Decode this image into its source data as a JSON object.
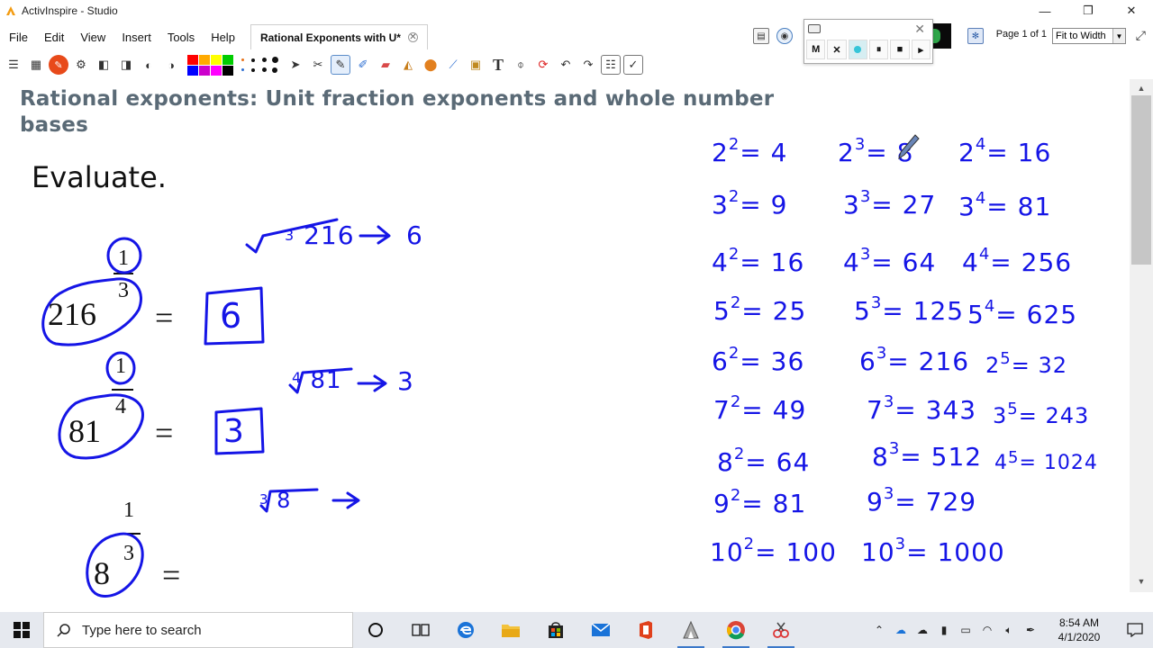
{
  "window": {
    "title": "ActivInspire - Studio",
    "controls": {
      "minimize": "—",
      "restore": "❐",
      "close": "✕"
    }
  },
  "menu": {
    "items": [
      "File",
      "Edit",
      "View",
      "Insert",
      "Tools",
      "Help"
    ]
  },
  "doc_tab": {
    "label": "Rational Exponents with U*"
  },
  "page_nav": {
    "page_label": "Page 1 of 1",
    "zoom": "Fit to Width"
  },
  "recorder": {
    "buttons": [
      "M",
      "✕",
      "",
      "⏸",
      "■",
      "▸"
    ]
  },
  "swatch_colors": [
    "#ff0000",
    "#ffaa00",
    "#ffff00",
    "#00cc00",
    "#0000ff",
    "#cc00cc",
    "#ff00ff",
    "#000000"
  ],
  "lesson": {
    "title": "Rational exponents: Unit fraction exponents and whole number bases",
    "instruction": "Evaluate.",
    "problems": [
      {
        "base": "216",
        "numerator": "1",
        "denominator": "3",
        "equals": "=",
        "work": "∛216 → 6",
        "answer": "6"
      },
      {
        "base": "81",
        "numerator": "1",
        "denominator": "4",
        "equals": "=",
        "work": "∜81 → 3",
        "answer": "3"
      },
      {
        "base": "8",
        "numerator": "1",
        "denominator": "3",
        "equals": "=",
        "work": "∛8 →",
        "answer": ""
      }
    ],
    "ink_color": "#1515e6",
    "power_table": [
      {
        "col": 1,
        "rows": [
          {
            "b": "2",
            "e": "2",
            "v": "= 4"
          },
          {
            "b": "3",
            "e": "2",
            "v": "= 9"
          },
          {
            "b": "4",
            "e": "2",
            "v": "= 16"
          },
          {
            "b": "5",
            "e": "2",
            "v": "= 25"
          },
          {
            "b": "6",
            "e": "2",
            "v": "= 36"
          },
          {
            "b": "7",
            "e": "2",
            "v": "= 49"
          },
          {
            "b": "8",
            "e": "2",
            "v": "= 64"
          },
          {
            "b": "9",
            "e": "2",
            "v": "= 81"
          },
          {
            "b": "10",
            "e": "2",
            "v": "= 100"
          }
        ]
      },
      {
        "col": 2,
        "rows": [
          {
            "b": "2",
            "e": "3",
            "v": "= 8"
          },
          {
            "b": "3",
            "e": "3",
            "v": "= 27"
          },
          {
            "b": "4",
            "e": "3",
            "v": "= 64"
          },
          {
            "b": "5",
            "e": "3",
            "v": "= 125"
          },
          {
            "b": "6",
            "e": "3",
            "v": "= 216"
          },
          {
            "b": "7",
            "e": "3",
            "v": "= 343"
          },
          {
            "b": "8",
            "e": "3",
            "v": "= 512"
          },
          {
            "b": "9",
            "e": "3",
            "v": "= 729"
          },
          {
            "b": "10",
            "e": "3",
            "v": "= 1000"
          }
        ]
      },
      {
        "col": 3,
        "rows": [
          {
            "b": "2",
            "e": "4",
            "v": "= 16"
          },
          {
            "b": "3",
            "e": "4",
            "v": "= 81"
          },
          {
            "b": "4",
            "e": "4",
            "v": "= 256"
          },
          {
            "b": "5",
            "e": "4",
            "v": "= 625"
          },
          {
            "b": "2",
            "e": "5",
            "v": "= 32"
          },
          {
            "b": "3",
            "e": "5",
            "v": "= 243"
          },
          {
            "b": "4",
            "e": "5",
            "v": "= 1024"
          }
        ]
      }
    ]
  },
  "taskbar": {
    "search_placeholder": "Type here to search",
    "time": "8:54 AM",
    "date": "4/1/2020"
  }
}
